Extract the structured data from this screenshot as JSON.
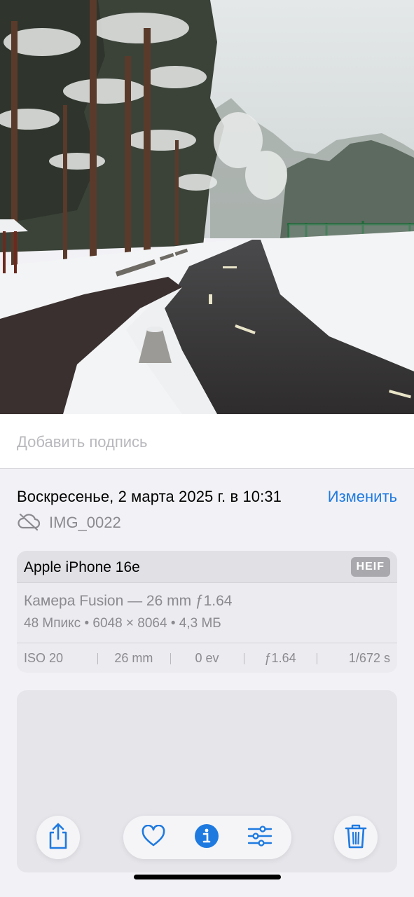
{
  "caption": {
    "placeholder": "Добавить подпись"
  },
  "date": {
    "text": "Воскресенье, 2 марта 2025 г. в 10:31",
    "edit_label": "Изменить"
  },
  "file": {
    "name": "IMG_0022",
    "icon": "cloud-slash-icon"
  },
  "device": {
    "name": "Apple iPhone 16e",
    "format_badge": "HEIF",
    "lens": "Камера Fusion — 26 mm ƒ1.64",
    "specs": "48 Мпикс  •  6048 × 8064  •  4,3 МБ"
  },
  "exif": [
    {
      "id": "iso",
      "value": "ISO 20"
    },
    {
      "id": "focal",
      "value": "26 mm"
    },
    {
      "id": "ev",
      "value": "0 ev"
    },
    {
      "id": "aperture",
      "value": "ƒ1.64"
    },
    {
      "id": "shutter",
      "value": "1/672 s"
    }
  ],
  "toolbar": {
    "share_icon": "share-icon",
    "favorite_icon": "heart-icon",
    "info_icon": "info-icon",
    "adjust_icon": "sliders-icon",
    "delete_icon": "trash-icon"
  },
  "colors": {
    "accent": "#1f7ae0",
    "secondary_text": "#8a8a8f",
    "background": "#f2f2f6"
  }
}
